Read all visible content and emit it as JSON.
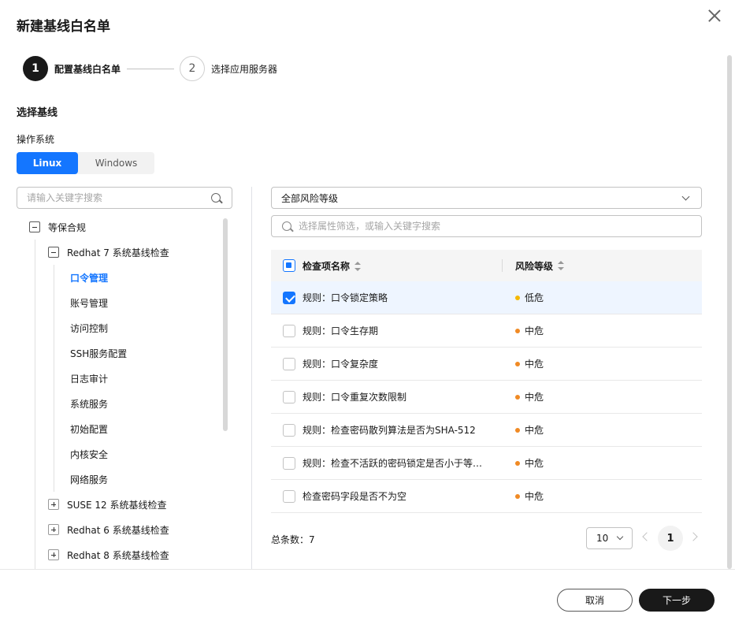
{
  "dialog": {
    "title": "新建基线白名单"
  },
  "steps": [
    {
      "num": "1",
      "label": "配置基线白名单"
    },
    {
      "num": "2",
      "label": "选择应用服务器"
    }
  ],
  "section": {
    "title": "选择基线",
    "os_label": "操作系统"
  },
  "os_tabs": [
    {
      "label": "Linux",
      "active": true
    },
    {
      "label": "Windows",
      "active": false
    }
  ],
  "tree": {
    "search_placeholder": "请输入关键字搜索",
    "root": "等保合规",
    "group": "Redhat 7 系统基线检查",
    "leaves": [
      "口令管理",
      "账号管理",
      "访问控制",
      "SSH服务配置",
      "日志审计",
      "系统服务",
      "初始配置",
      "内核安全",
      "网络服务"
    ],
    "collapsed": [
      "SUSE 12 系统基线检查",
      "Redhat 6 系统基线检查",
      "Redhat 8 系统基线检查"
    ]
  },
  "risk_select": {
    "value": "全部风险等级"
  },
  "filter": {
    "placeholder": "选择属性筛选，或输入关键字搜索"
  },
  "table": {
    "headers": {
      "name": "检查项名称",
      "risk": "风险等级"
    },
    "rows": [
      {
        "name": "规则：口令锁定策略",
        "risk": "低危",
        "checked": true
      },
      {
        "name": "规则：口令生存期",
        "risk": "中危",
        "checked": false
      },
      {
        "name": "规则：口令复杂度",
        "risk": "中危",
        "checked": false
      },
      {
        "name": "规则：口令重复次数限制",
        "risk": "中危",
        "checked": false
      },
      {
        "name": "规则：检查密码散列算法是否为SHA-512",
        "risk": "中危",
        "checked": false
      },
      {
        "name": "规则：检查不活跃的密码锁定是否小于等…",
        "risk": "中危",
        "checked": false
      },
      {
        "name": "检查密码字段是否不为空",
        "risk": "中危",
        "checked": false
      }
    ]
  },
  "risk_colors": {
    "低危": "#f5b800",
    "中危": "#f08a24"
  },
  "pagination": {
    "total_label": "总条数：7",
    "page_size": "10",
    "current": "1"
  },
  "footer": {
    "cancel": "取消",
    "next": "下一步"
  }
}
